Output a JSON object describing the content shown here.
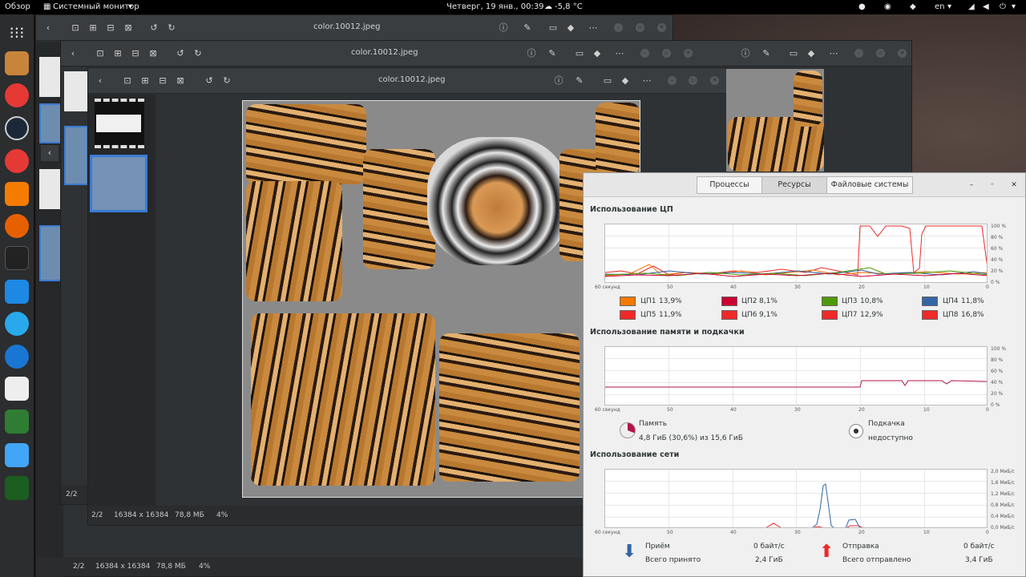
{
  "topbar": {
    "overview": "Обзор",
    "app_menu": "Системный монитор",
    "clock": "Четверг, 19 янв., 00:39",
    "weather": "-5,8 °C",
    "lang": "en"
  },
  "viewer": {
    "filename": "color.10012.jpeg",
    "status_index": "2/2",
    "status_dims": "16384 x 16384",
    "status_size": "78,8 МБ",
    "status_zoom": "4%"
  },
  "sysmon": {
    "tabs": [
      "Процессы",
      "Ресурсы",
      "Файловые системы"
    ],
    "cpu_title": "Использование ЦП",
    "mem_title": "Использование памяти и подкачки",
    "net_title": "Использование сети",
    "x_ticks": [
      "60 секунд",
      "50",
      "40",
      "30",
      "20",
      "10",
      "0"
    ],
    "pct_ticks": [
      "100 %",
      "80 %",
      "60 %",
      "40 %",
      "20 %",
      "0 %"
    ],
    "net_ticks": [
      "2,0 МиБ/с",
      "1,6 МиБ/с",
      "1,2 МиБ/с",
      "0,8 МиБ/с",
      "0,4 МиБ/с",
      "0,0 МиБ/с"
    ],
    "cpus": [
      {
        "label": "ЦП1",
        "value": "13,9%",
        "color": "#f57900"
      },
      {
        "label": "ЦП2",
        "value": "8,1%",
        "color": "#cc0033"
      },
      {
        "label": "ЦП3",
        "value": "10,8%",
        "color": "#4e9a06"
      },
      {
        "label": "ЦП4",
        "value": "11,8%",
        "color": "#3465a4"
      },
      {
        "label": "ЦП5",
        "value": "11,9%",
        "color": "#ef2929"
      },
      {
        "label": "ЦП6",
        "value": "9,1%",
        "color": "#ef2929"
      },
      {
        "label": "ЦП7",
        "value": "12,9%",
        "color": "#ef2929"
      },
      {
        "label": "ЦП8",
        "value": "16,8%",
        "color": "#ef2929"
      }
    ],
    "memory": {
      "label": "Память",
      "value": "4,8 ГиБ (30,6%) из 15,6 ГиБ"
    },
    "swap": {
      "label": "Подкачка",
      "value": "недоступно"
    },
    "recv": {
      "label": "Приём",
      "rate": "0 байт/с",
      "total_label": "Всего принято",
      "total": "2,4 ГиБ"
    },
    "send": {
      "label": "Отправка",
      "rate": "0 байт/с",
      "total_label": "Всего отправлено",
      "total": "3,4 ГиБ"
    }
  }
}
